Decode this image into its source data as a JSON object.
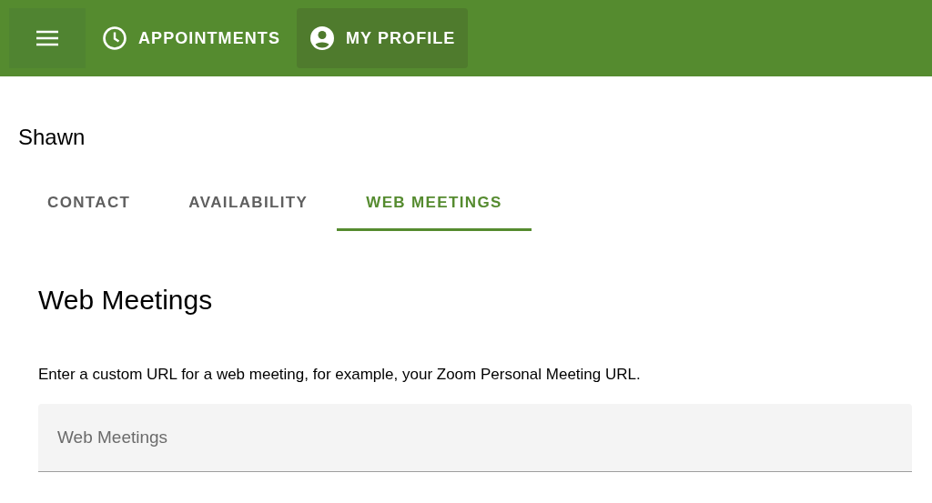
{
  "nav": {
    "menu_button": true,
    "items": [
      {
        "label": "APPOINTMENTS",
        "kind": "clock",
        "selected": false
      },
      {
        "label": "MY PROFILE",
        "kind": "account",
        "selected": true
      }
    ]
  },
  "profile_name": "Shawn",
  "tabs": [
    {
      "label": "CONTACT",
      "selected": false
    },
    {
      "label": "AVAILABILITY",
      "selected": false
    },
    {
      "label": "WEB MEETINGS",
      "selected": true
    }
  ],
  "section": {
    "title": "Web Meetings",
    "description": "Enter a custom URL for a web meeting, for example, your Zoom Personal Meeting URL.",
    "field": {
      "placeholder": "Web Meetings"
    }
  }
}
